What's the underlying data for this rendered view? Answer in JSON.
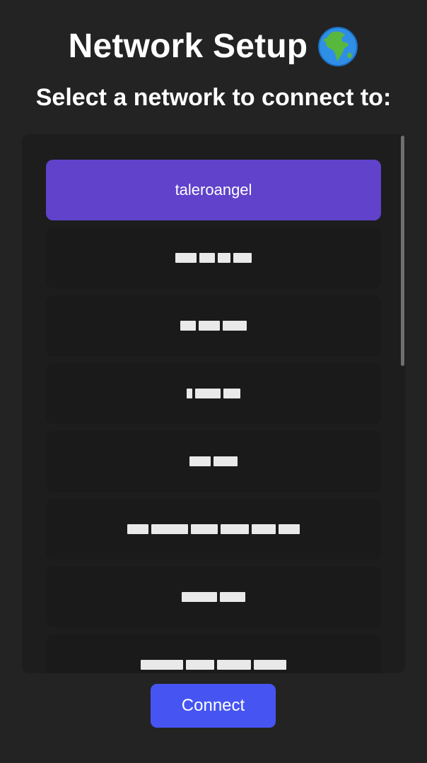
{
  "header": {
    "title": "Network Setup",
    "title_icon": "globe-icon",
    "subtitle": "Select a network to connect to:"
  },
  "networks": [
    {
      "label": "taleroangel",
      "selected": true
    },
    {
      "label": "",
      "selected": false,
      "obscured": true
    },
    {
      "label": "",
      "selected": false,
      "obscured": true
    },
    {
      "label": "",
      "selected": false,
      "obscured": true
    },
    {
      "label": "",
      "selected": false,
      "obscured": true
    },
    {
      "label": "",
      "selected": false,
      "obscured": true
    },
    {
      "label": "",
      "selected": false,
      "obscured": true
    },
    {
      "label": "",
      "selected": false,
      "obscured": true
    }
  ],
  "actions": {
    "connect_label": "Connect"
  },
  "colors": {
    "background": "#232323",
    "list_background": "#1d1d1d",
    "item_background": "#1a1a1a",
    "selected_item": "#6042cb",
    "connect_button": "#4655f2"
  }
}
